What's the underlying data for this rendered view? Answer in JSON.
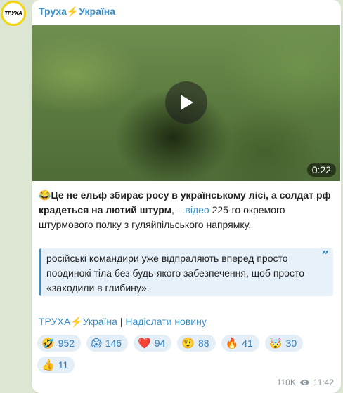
{
  "channel": {
    "name": "Труха⚡Україна",
    "avatar_text": "ТРУХА"
  },
  "video": {
    "duration": "0:22"
  },
  "post": {
    "emoji": "😂",
    "bold_text": "Це не ельф збирає росу в українському лісі, а солдат рф крадеться на лютий штурм",
    "dash": ", – ",
    "link_text": "відео",
    "rest_text": " 225-го окремого штурмового полку з гуляйпільського напрямку."
  },
  "quote": {
    "text": "російські командири уже відпраляють вперед просто поодинокі тіла без будь-якого забезпечення, щоб просто «заходили в глибину».",
    "mark": "”"
  },
  "footer": {
    "channel_link": "ТРУХА⚡Україна",
    "separator": " | ",
    "submit_link": "Надіслати новину"
  },
  "reactions": [
    {
      "emoji": "🤣",
      "count": "952"
    },
    {
      "emoji": "😱",
      "count": "146"
    },
    {
      "emoji": "❤️",
      "count": "94"
    },
    {
      "emoji": "🤨",
      "count": "88"
    },
    {
      "emoji": "🔥",
      "count": "41"
    },
    {
      "emoji": "🤯",
      "count": "30"
    },
    {
      "emoji": "👍",
      "count": "11"
    }
  ],
  "meta": {
    "views": "110K",
    "time": "11:42"
  },
  "colors": {
    "accent": "#3a8fc7",
    "background": "#dce6d3",
    "reaction_bg": "#e3eef7"
  }
}
